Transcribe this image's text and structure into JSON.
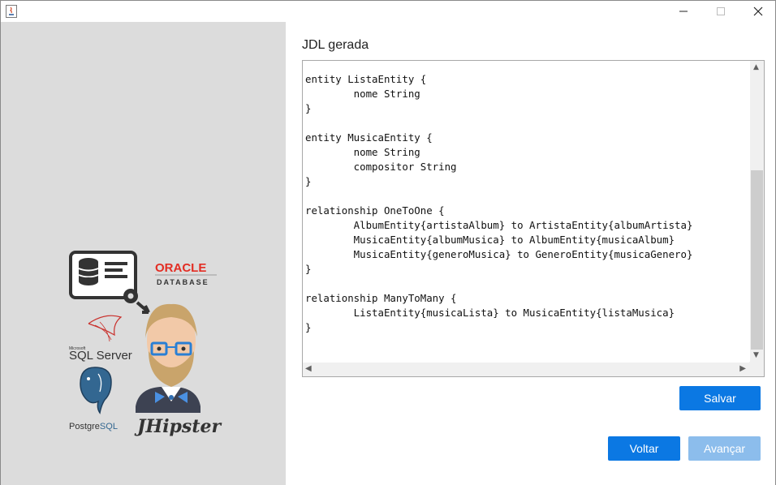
{
  "window": {
    "app_icon": "java-cup-icon",
    "controls": [
      "minimize-icon",
      "maximize-icon",
      "close-icon"
    ]
  },
  "left_panel": {
    "logos": {
      "oracle_top": "ORACLE",
      "oracle_bottom": "DATABASE",
      "sqlserver_small": "Microsoft",
      "sqlserver": "SQL Server",
      "postgres": "Postgre",
      "postgres_sql": "SQL",
      "jhipster": "JHipster"
    }
  },
  "editor": {
    "label": "JDL gerada",
    "lines": [
      "entity ListaEntity {",
      "        nome String",
      "}",
      "",
      "entity MusicaEntity {",
      "        nome String",
      "        compositor String",
      "}",
      "",
      "relationship OneToOne {",
      "        AlbumEntity{artistaAlbum} to ArtistaEntity{albumArtista}",
      "        MusicaEntity{albumMusica} to AlbumEntity{musicaAlbum}",
      "        MusicaEntity{generoMusica} to GeneroEntity{musicaGenero}",
      "}",
      "",
      "relationship ManyToMany {",
      "        ListaEntity{musicaLista} to MusicaEntity{listaMusica}",
      "}"
    ]
  },
  "buttons": {
    "save": "Salvar",
    "back": "Voltar",
    "next": "Avançar"
  },
  "colors": {
    "primary": "#0b78e3",
    "disabled": "#8cbdec",
    "left_panel_bg": "#dcdcdc"
  }
}
